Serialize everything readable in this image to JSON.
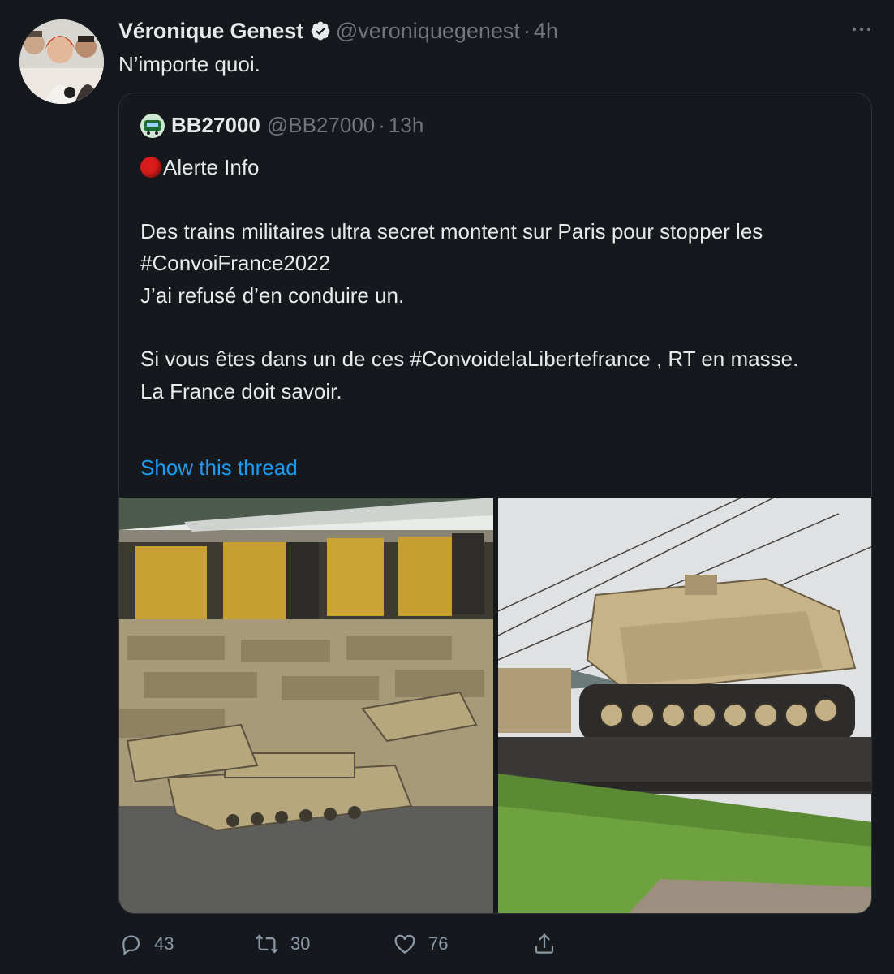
{
  "tweet": {
    "author_name": "Véronique Genest",
    "author_handle": "@veroniquegenest",
    "separator": "·",
    "time": "4h",
    "text": "N’importe quoi."
  },
  "quoted": {
    "author_name": "BB27000",
    "author_handle": "@BB27000",
    "separator": "·",
    "time": "13h",
    "line1": "Alerte Info",
    "line2": "Des trains militaires ultra secret montent sur Paris pour stopper les #ConvoiFrance2022",
    "line3": "J’ai refusé d’en conduire un.",
    "line4": "Si vous êtes dans un de ces #ConvoidelaLibertefrance , RT en masse.",
    "line5": "La France doit savoir.",
    "show_thread": "Show this thread"
  },
  "actions": {
    "replies": "43",
    "retweets": "30",
    "likes": "76"
  },
  "icons": [
    "verified-badge-icon",
    "more-icon",
    "red-circle-icon",
    "reply-icon",
    "retweet-icon",
    "like-icon",
    "share-icon"
  ],
  "colors": {
    "background": "#15181c",
    "link": "#1d9bf0",
    "muted": "#71767b",
    "text": "#e7e9ea"
  }
}
